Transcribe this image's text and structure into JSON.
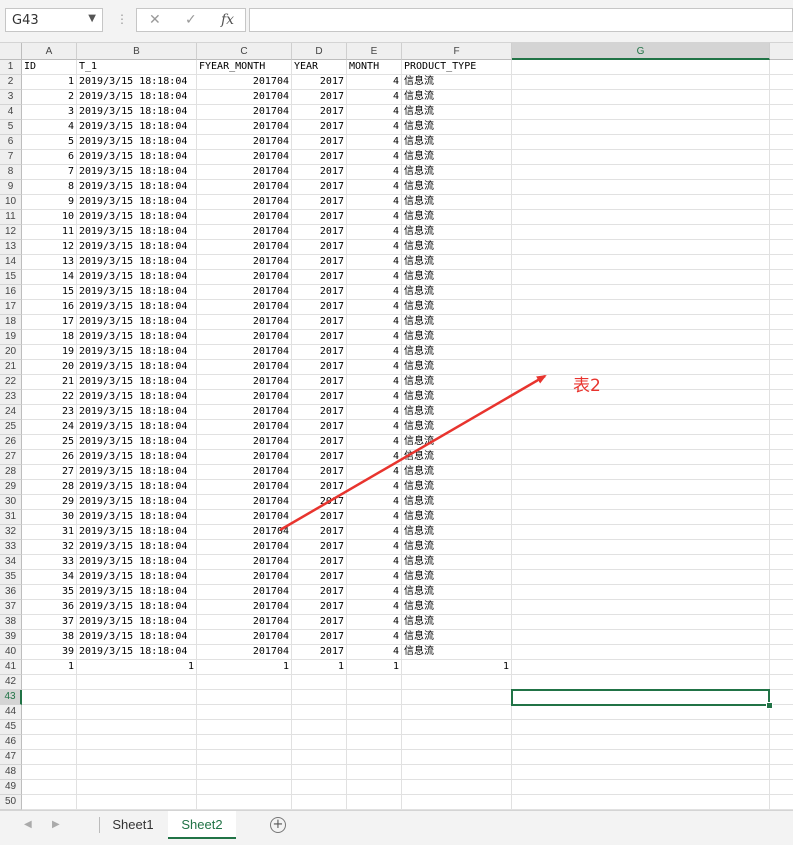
{
  "formula_bar": {
    "name_box": "G43",
    "cancel_icon": "✕",
    "enter_icon": "✓",
    "fx_label": "fx",
    "formula": ""
  },
  "columns": [
    "A",
    "B",
    "C",
    "D",
    "E",
    "F",
    "G"
  ],
  "header_row": [
    "ID",
    "T_1",
    "FYEAR_MONTH",
    "YEAR",
    "MONTH",
    "PRODUCT_TYPE"
  ],
  "data_row_template": {
    "t_1": "2019/3/15 18:18:04",
    "fyear_month": "201704",
    "year": "2017",
    "month": "4",
    "product_type": "信息流"
  },
  "data_ids": [
    "1",
    "2",
    "3",
    "4",
    "5",
    "6",
    "7",
    "8",
    "9",
    "10",
    "11",
    "12",
    "13",
    "14",
    "15",
    "16",
    "17",
    "18",
    "19",
    "20",
    "21",
    "22",
    "23",
    "24",
    "25",
    "26",
    "27",
    "28",
    "29",
    "30",
    "31",
    "32",
    "33",
    "34",
    "35",
    "36",
    "37",
    "38",
    "39"
  ],
  "row41": [
    "1",
    "1",
    "1",
    "1",
    "1",
    "1"
  ],
  "row_numbers": [
    "1",
    "2",
    "3",
    "4",
    "5",
    "6",
    "7",
    "8",
    "9",
    "10",
    "11",
    "12",
    "13",
    "14",
    "15",
    "16",
    "17",
    "18",
    "19",
    "20",
    "21",
    "22",
    "23",
    "24",
    "25",
    "26",
    "27",
    "28",
    "29",
    "30",
    "31",
    "32",
    "33",
    "34",
    "35",
    "36",
    "37",
    "38",
    "39",
    "40",
    "41",
    "42",
    "43",
    "44",
    "45",
    "46",
    "47",
    "48",
    "49",
    "50"
  ],
  "selected": {
    "column": "G",
    "row": "43"
  },
  "annotation": {
    "text": "表2",
    "color": "#e8342e"
  },
  "sheets": {
    "tabs": [
      {
        "label": "Sheet1",
        "active": false
      },
      {
        "label": "Sheet2",
        "active": true
      }
    ],
    "add_icon": "+"
  },
  "colors": {
    "accent": "#217346",
    "annotation": "#e8342e"
  }
}
